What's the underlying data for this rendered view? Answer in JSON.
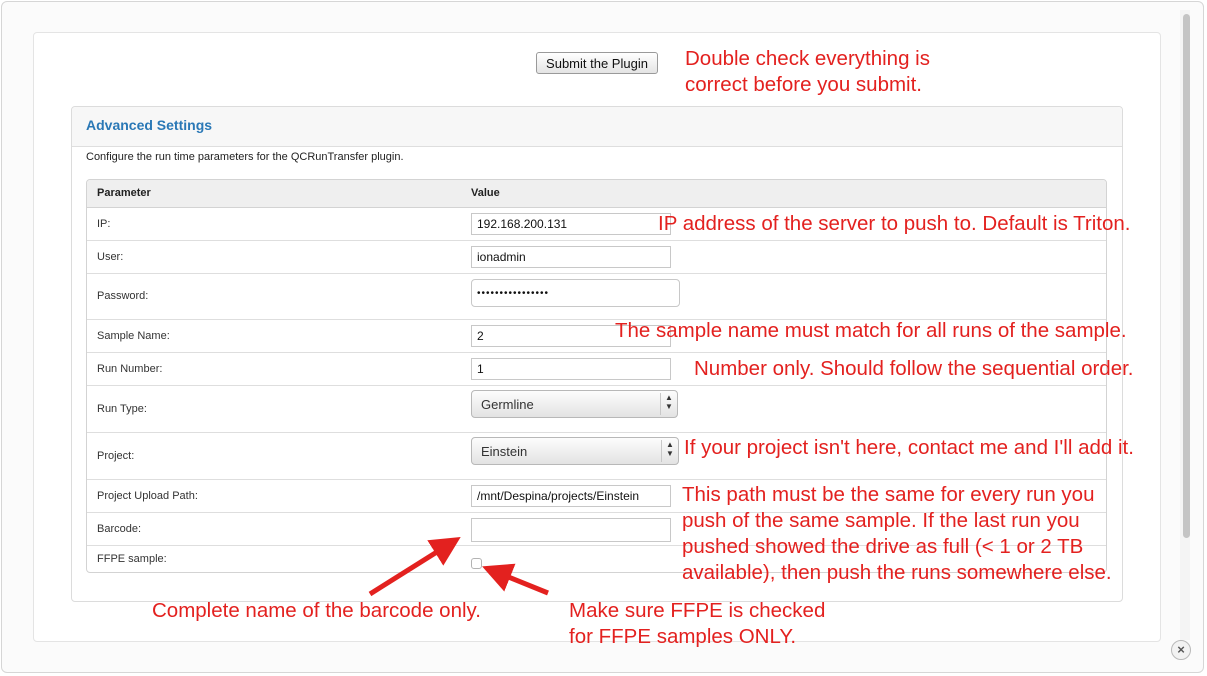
{
  "submit_button": "Submit the Plugin",
  "panel": {
    "title": "Advanced Settings",
    "description": "Configure the run time parameters for the QCRunTransfer plugin."
  },
  "table": {
    "headers": [
      "Parameter",
      "Value"
    ],
    "rows": [
      {
        "label": "IP:",
        "value": "192.168.200.131"
      },
      {
        "label": "User:",
        "value": "ionadmin"
      },
      {
        "label": "Password:",
        "value": "••••••••••••••••"
      },
      {
        "label": "Sample Name:",
        "value": "2"
      },
      {
        "label": "Run Number:",
        "value": "1"
      },
      {
        "label": "Run Type:",
        "value": "Germline"
      },
      {
        "label": "Project:",
        "value": "Einstein"
      },
      {
        "label": "Project Upload Path:",
        "value": "/mnt/Despina/projects/Einstein"
      },
      {
        "label": "Barcode:",
        "value": ""
      },
      {
        "label": "FFPE sample:",
        "checked": false
      }
    ]
  },
  "annotations": {
    "submit": [
      "Double check everything is",
      "correct before you submit."
    ],
    "ip": "IP address of the server to push to. Default is Triton.",
    "sample": "The sample name must match for all runs of the sample.",
    "run": "Number only. Should follow the sequential order.",
    "project": "If your project isn't here, contact me and I'll add it.",
    "path": [
      "This path must be the same for every run you",
      "push of the same sample. If the last run you",
      "pushed showed the drive as full (< 1 or 2 TB",
      "available), then push the runs somewhere else."
    ],
    "barcode": "Complete name of the barcode only.",
    "ffpe": [
      "Make sure FFPE is checked",
      "for FFPE samples ONLY."
    ]
  },
  "colors": {
    "annotation": "#e3211f",
    "panel_title": "#2a78b6"
  },
  "icons": {
    "close": "close-icon",
    "select_arrow": "updown-arrow-icon"
  }
}
